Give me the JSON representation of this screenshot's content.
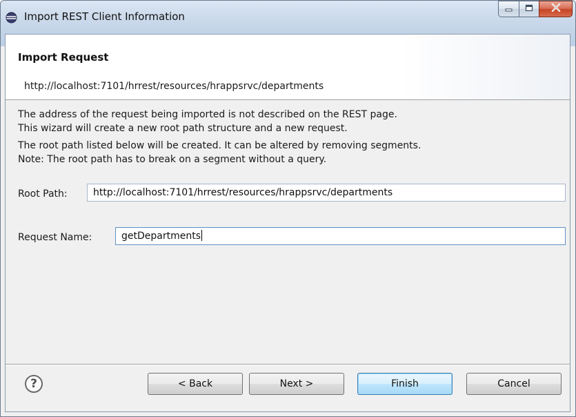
{
  "window": {
    "title": "Import REST Client Information"
  },
  "header": {
    "title": "Import Request",
    "url": "http://localhost:7101/hrrest/resources/hrappsrvc/departments"
  },
  "body": {
    "paragraph1_line1": "The address of the request being imported is not described on the REST page.",
    "paragraph1_line2": "This wizard will create a new root path structure and a new request.",
    "paragraph2_line1": "The root path listed below will be created.  It can be altered by removing segments.",
    "paragraph2_line2": "Note: The root path has to break on a segment without a query."
  },
  "form": {
    "root_path_label": "Root Path:",
    "root_path_value": "http://localhost:7101/hrrest/resources/hrappsrvc/departments",
    "request_name_label": "Request Name:",
    "request_name_value": "getDepartments"
  },
  "buttons": {
    "help": "?",
    "back": "< Back",
    "next": "Next >",
    "finish": "Finish",
    "cancel": "Cancel"
  },
  "icons": {
    "app": "eclipse-icon",
    "minimize": "minimize-icon",
    "maximize": "maximize-icon",
    "close": "close-icon"
  },
  "colors": {
    "titlebar": "#c9d8ea",
    "close_button": "#c74525",
    "default_button_border": "#3c7fb1"
  }
}
